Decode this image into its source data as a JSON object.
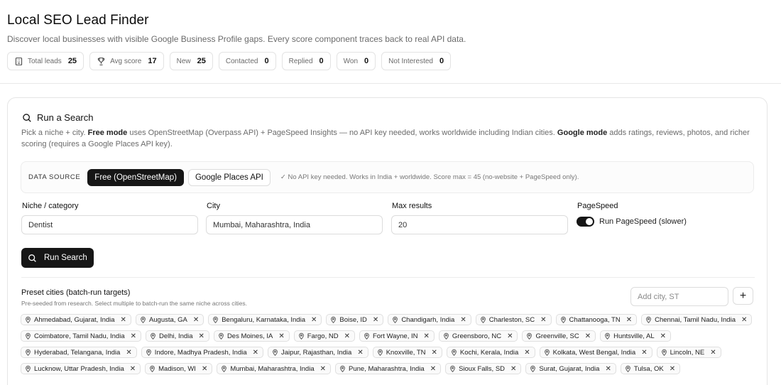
{
  "header": {
    "title": "Local SEO Lead Finder",
    "subtitle": "Discover local businesses with visible Google Business Profile gaps. Every score component traces back to real API data."
  },
  "stats": [
    {
      "label": "Total leads",
      "value": "25",
      "icon": "building-icon"
    },
    {
      "label": "Avg score",
      "value": "17",
      "icon": "trophy-icon"
    },
    {
      "label": "New",
      "value": "25"
    },
    {
      "label": "Contacted",
      "value": "0"
    },
    {
      "label": "Replied",
      "value": "0"
    },
    {
      "label": "Won",
      "value": "0"
    },
    {
      "label": "Not Interested",
      "value": "0"
    }
  ],
  "search": {
    "title": "Run a Search",
    "desc": {
      "p1": "Pick a niche + city. ",
      "b1": "Free mode",
      "p2": " uses OpenStreetMap (Overpass API) + PageSpeed Insights — no API key needed, works worldwide including Indian cities. ",
      "b2": "Google mode",
      "p3": " adds ratings, reviews, photos, and richer scoring (requires a Google Places API key)."
    },
    "data_source": {
      "label": "DATA SOURCE",
      "free": "Free (OpenStreetMap)",
      "google": "Google Places API",
      "note": "✓ No API key needed. Works in India + worldwide. Score max = 45 (no-website + PageSpeed only)."
    },
    "fields": {
      "niche_label": "Niche / category",
      "niche_value": "Dentist",
      "city_label": "City",
      "city_value": "Mumbai, Maharashtra, India",
      "max_label": "Max results",
      "max_value": "20",
      "pagespeed_label": "PageSpeed",
      "pagespeed_toggle": "Run PageSpeed (slower)"
    },
    "run_button": "Run Search"
  },
  "presets": {
    "title": "Preset cities (batch-run targets)",
    "subtitle": "Pre-seeded from research. Select multiple to batch-run the same niche across cities.",
    "add_placeholder": "Add city, ST",
    "add_button": "+",
    "cities": [
      "Ahmedabad, Gujarat, India",
      "Augusta, GA",
      "Bengaluru, Karnataka, India",
      "Boise, ID",
      "Chandigarh, India",
      "Charleston, SC",
      "Chattanooga, TN",
      "Chennai, Tamil Nadu, India",
      "Coimbatore, Tamil Nadu, India",
      "Delhi, India",
      "Des Moines, IA",
      "Fargo, ND",
      "Fort Wayne, IN",
      "Greensboro, NC",
      "Greenville, SC",
      "Huntsville, AL",
      "Hyderabad, Telangana, India",
      "Indore, Madhya Pradesh, India",
      "Jaipur, Rajasthan, India",
      "Knoxville, TN",
      "Kochi, Kerala, India",
      "Kolkata, West Bengal, India",
      "Lincoln, NE",
      "Lucknow, Uttar Pradesh, India",
      "Madison, WI",
      "Mumbai, Maharashtra, India",
      "Pune, Maharashtra, India",
      "Sioux Falls, SD",
      "Surat, Gujarat, India",
      "Tulsa, OK"
    ]
  }
}
